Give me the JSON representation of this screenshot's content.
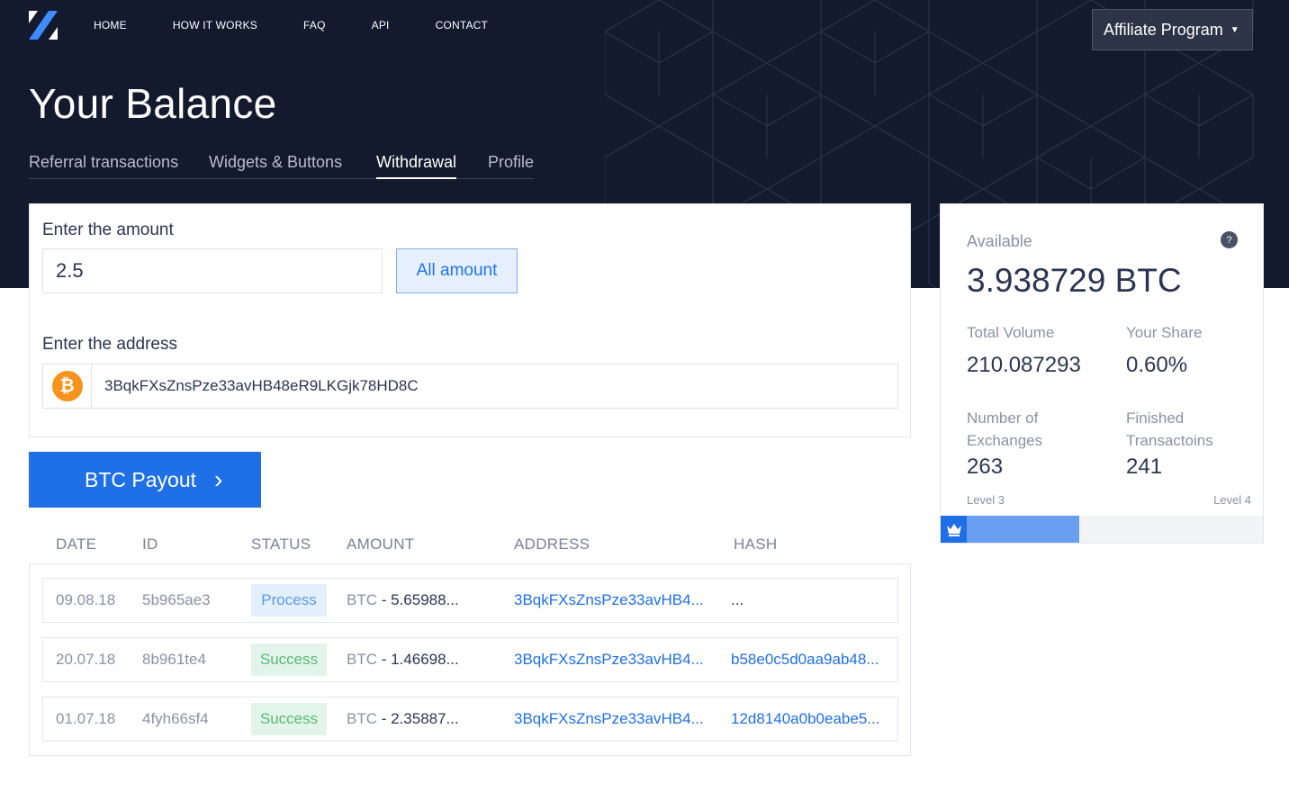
{
  "nav": {
    "items": [
      "HOME",
      "HOW IT WORKS",
      "FAQ",
      "API",
      "CONTACT"
    ],
    "affiliate_label": "Affiliate Program"
  },
  "page_title": "Your Balance",
  "tabs": [
    {
      "label": "Referral transactions",
      "active": false
    },
    {
      "label": "Widgets & Buttons",
      "active": false
    },
    {
      "label": "Withdrawal",
      "active": true
    },
    {
      "label": "Profile",
      "active": false
    }
  ],
  "form": {
    "amount_label": "Enter the amount",
    "amount_value": "2.5",
    "all_amount_label": "All amount",
    "address_label": "Enter the address",
    "address_value": "3BqkFXsZnsPze33avHB48eR9LKGjk78HD8C",
    "coin_symbol": "₿"
  },
  "payout_button": {
    "label": "BTC Payout",
    "chevron": "›"
  },
  "table": {
    "headers": [
      "DATE",
      "ID",
      "STATUS",
      "AMOUNT",
      "ADDRESS",
      "HASH"
    ],
    "rows": [
      {
        "date": "09.08.18",
        "id": "5b965ae3",
        "status": "Process",
        "currency": "BTC",
        "amount": " - 5.65988...",
        "address": "3BqkFXsZnsPze33avHB4...",
        "hash": "..."
      },
      {
        "date": "20.07.18",
        "id": "8b961te4",
        "status": "Success",
        "currency": "BTC",
        "amount": " - 1.46698...",
        "address": "3BqkFXsZnsPze33avHB4...",
        "hash": "b58e0c5d0aa9ab48..."
      },
      {
        "date": "01.07.18",
        "id": "4fyh66sf4",
        "status": "Success",
        "currency": "BTC",
        "amount": " - 2.35887...",
        "address": "3BqkFXsZnsPze33avHB4...",
        "hash": "12d8140a0b0eabe5..."
      }
    ]
  },
  "balance": {
    "available_label": "Available",
    "available_value": "3.938729 BTC",
    "help_symbol": "?",
    "total_volume_label": "Total Volume",
    "total_volume_value": "210.087293",
    "your_share_label": "Your Share",
    "your_share_value": "0.60%",
    "exchanges_label_1": "Number of",
    "exchanges_label_2": "Exchanges",
    "exchanges_value": "263",
    "finished_label_1": "Finished",
    "finished_label_2": "Transactoins",
    "finished_value": "241",
    "level_current": "Level 3",
    "level_next": "Level 4",
    "level_progress": 0.43
  },
  "colors": {
    "hero_bg": "#131a2e",
    "accent": "#1f6fe6",
    "process": "#5a9ae8",
    "success": "#57b97a",
    "btc": "#f7931a"
  }
}
